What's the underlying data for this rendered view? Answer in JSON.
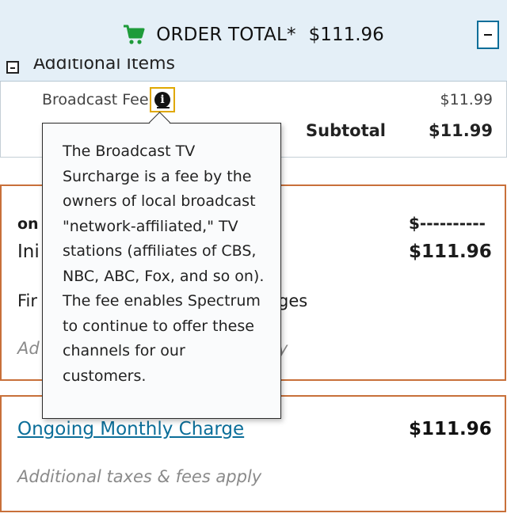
{
  "header": {
    "icon": "shopping-cart-icon",
    "icon_color": "#1e9b3a",
    "label": "ORDER TOTAL*",
    "total": "$111.96"
  },
  "additional_items": {
    "title": "Additional Items",
    "broadcast_fee_label": "Broadcast Fee",
    "broadcast_fee_amount": "$11.99",
    "subtotal_label": "Subtotal",
    "subtotal_amount": "$11.99"
  },
  "tooltip": {
    "text": "The Broadcast TV Surcharge is a fee by the owners of local broadcast \"network-affiliated,\" TV stations (affiliates of CBS, NBC, ABC, Fox, and so on). The fee enables Spectrum to continue to offer these channels for our customers."
  },
  "one_time": {
    "heading_fragment": "on",
    "initial_fragment": "Ini",
    "first_fragment": "Fir",
    "charges_fragment": "ges",
    "taxes_fragment": "Ad",
    "taxes_tail_fragment": "y",
    "dash_amount": "$----------",
    "amount": "$111.96"
  },
  "monthly": {
    "link_label": "Ongoing Monthly Charge",
    "amount": "$111.96",
    "note": "Additional taxes & fees apply"
  },
  "colors": {
    "header_bg": "#e4eff7",
    "link": "#0b6e99",
    "box_border": "#c8703a",
    "focus_outline": "#e0a800"
  }
}
